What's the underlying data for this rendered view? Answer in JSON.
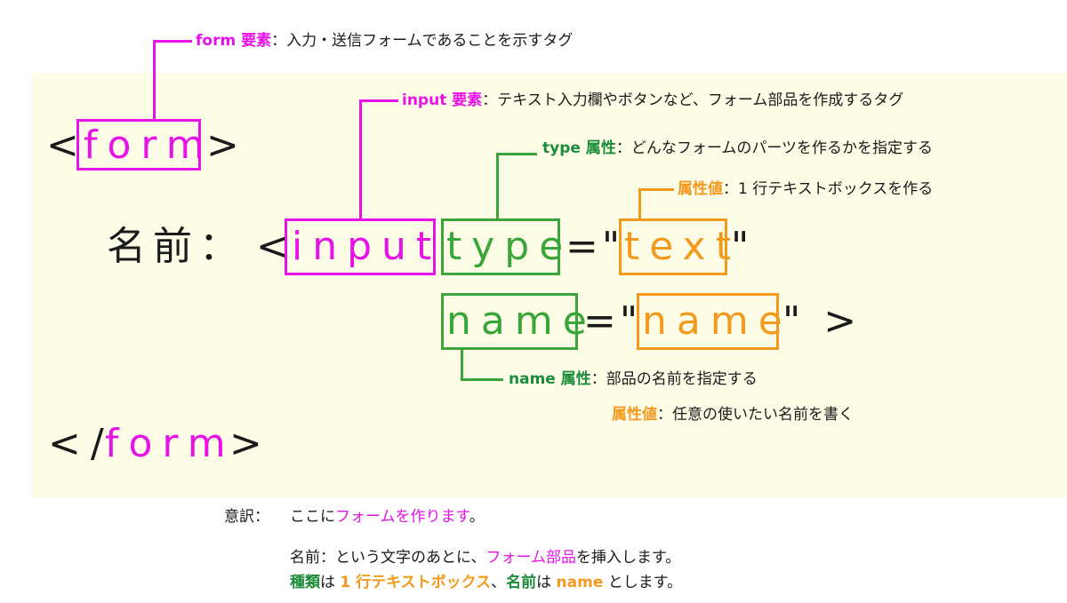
{
  "code": {
    "open_lt": "<",
    "open_tag": "form",
    "open_gt": ">",
    "label": "名前：",
    "input_lt": "<",
    "input_tag": "input",
    "type_attr": "type",
    "eq1": "=\"",
    "type_value": "text",
    "q1": "\"",
    "name_attr": "name",
    "eq2": "=\"",
    "name_value": "name",
    "end": "\" >",
    "close_lt": "</",
    "close_tag": "form",
    "close_gt": ">"
  },
  "annotations": {
    "form": {
      "term": "form 要素",
      "desc": "：入力・送信フォームであることを示すタグ"
    },
    "input": {
      "term": "input 要素",
      "desc": "：テキスト入力欄やボタンなど、フォーム部品を作成するタグ"
    },
    "type": {
      "term": "type 属性",
      "desc": "：どんなフォームのパーツを作るかを指定する"
    },
    "type_value": {
      "term": "属性値",
      "desc": "：1 行テキストボックスを作る"
    },
    "name": {
      "term": "name 属性",
      "desc": "：部品の名前を指定する"
    },
    "name_value": {
      "term": "属性値",
      "desc": "：任意の使いたい名前を書く"
    }
  },
  "translation": {
    "label": "意訳：",
    "line1": {
      "a": "ここに",
      "b": "フォームを作ります",
      "c": "。"
    },
    "line2": {
      "a": "名前：という文字のあとに、",
      "b": "フォーム部品",
      "c": "を挿入します。"
    },
    "line3": {
      "a": "種類",
      "b": "は",
      "c": "1 行テキストボックス",
      "d": "、",
      "e": "名前",
      "f": "は",
      "g": "name",
      "h": "とします。"
    }
  },
  "colors": {
    "magenta": "#e612e6",
    "green": "#3aa63a",
    "orange": "#f39a1e",
    "background": "#fdfde7"
  }
}
